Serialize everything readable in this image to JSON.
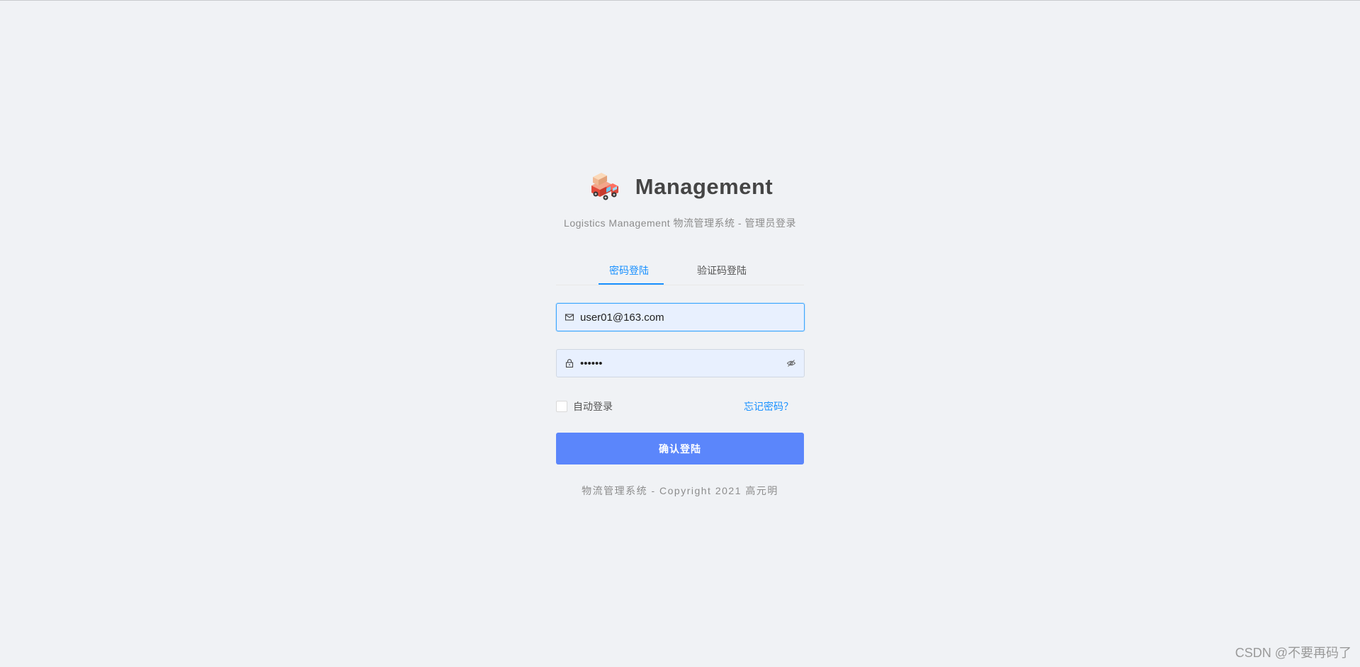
{
  "header": {
    "title": "Management",
    "subtitle": "Logistics Management 物流管理系统 - 管理员登录",
    "logo_icon": "delivery-truck-icon"
  },
  "tabs": [
    {
      "label": "密码登陆",
      "active": true
    },
    {
      "label": "验证码登陆",
      "active": false
    }
  ],
  "form": {
    "email": {
      "value": "user01@163.com",
      "icon": "mail-icon"
    },
    "password": {
      "value": "••••••",
      "icon": "lock-icon",
      "toggle_icon": "eye-invisible-icon"
    },
    "remember_label": "自动登录",
    "remember_checked": false,
    "forgot_label": "忘记密码？",
    "submit_label": "确认登陆"
  },
  "footer": {
    "copyright": "物流管理系统 - Copyright 2021 高元明"
  },
  "watermark": "CSDN @不要再码了",
  "colors": {
    "accent": "#1890ff",
    "button": "#5b86fb",
    "background": "#f0f2f5",
    "input_bg": "#e8f0fe"
  }
}
